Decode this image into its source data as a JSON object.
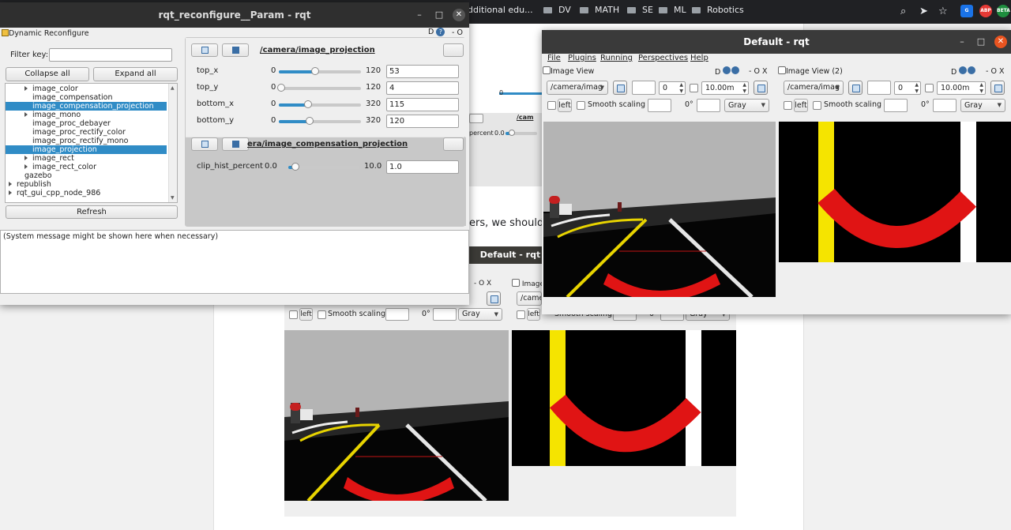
{
  "browser": {
    "bookmarks": [
      "dditional edu...",
      "DV",
      "MATH",
      "SE",
      "ML",
      "Robotics"
    ],
    "extensions": [
      "ABP",
      "BETA"
    ]
  },
  "doc": {
    "snippet": "ers, we should g"
  },
  "background_rqt": {
    "title": "Default - rqt",
    "param_fragment": "/cam",
    "clip_label": "percent",
    "clip_min": "0.0",
    "dock_label": "Image",
    "topic": "/camer",
    "left_label": "left",
    "smooth_label": "Smooth scaling",
    "rotation": "0°",
    "color_scheme": "Gray",
    "controls": "- O X"
  },
  "reconfigure_window": {
    "title": "rqt_reconfigure__Param - rqt",
    "plugin_title": "Dynamic Reconfigure",
    "dock_controls": "D",
    "dock_close": "- O X",
    "filter_label": "Filter key:",
    "filter_value": "",
    "collapse_all": "Collapse all",
    "expand_all": "Expand all",
    "tree": [
      {
        "label": "image_color",
        "indent": 2,
        "arrow": true,
        "selected": false
      },
      {
        "label": "image_compensation",
        "indent": 2,
        "arrow": false,
        "selected": false
      },
      {
        "label": "image_compensation_projection",
        "indent": 2,
        "arrow": false,
        "selected": true
      },
      {
        "label": "image_mono",
        "indent": 2,
        "arrow": true,
        "selected": false
      },
      {
        "label": "image_proc_debayer",
        "indent": 2,
        "arrow": false,
        "selected": false
      },
      {
        "label": "image_proc_rectify_color",
        "indent": 2,
        "arrow": false,
        "selected": false
      },
      {
        "label": "image_proc_rectify_mono",
        "indent": 2,
        "arrow": false,
        "selected": false
      },
      {
        "label": "image_projection",
        "indent": 2,
        "arrow": false,
        "selected": true
      },
      {
        "label": "image_rect",
        "indent": 2,
        "arrow": true,
        "selected": false
      },
      {
        "label": "image_rect_color",
        "indent": 2,
        "arrow": true,
        "selected": false
      },
      {
        "label": "gazebo",
        "indent": 1,
        "arrow": false,
        "selected": false
      },
      {
        "label": "republish",
        "indent": 0,
        "arrow": true,
        "selected": false
      },
      {
        "label": "rqt_gui_cpp_node_986",
        "indent": 0,
        "arrow": true,
        "selected": false
      }
    ],
    "refresh": "Refresh",
    "group1": {
      "title": "/camera/image_projection",
      "params": [
        {
          "name": "top_x",
          "min": "0",
          "max": "120",
          "value": "53",
          "fraction": 0.44
        },
        {
          "name": "top_y",
          "min": "0",
          "max": "120",
          "value": "4",
          "fraction": 0.03
        },
        {
          "name": "bottom_x",
          "min": "0",
          "max": "320",
          "value": "115",
          "fraction": 0.36
        },
        {
          "name": "bottom_y",
          "min": "0",
          "max": "320",
          "value": "120",
          "fraction": 0.375
        }
      ]
    },
    "group2": {
      "title": "era/image_compensation_projection",
      "params": [
        {
          "name": "clip_hist_percent",
          "min": "0.0",
          "max": "10.0",
          "value": "1.0",
          "fraction": 0.1
        }
      ]
    },
    "system_message": "(System message might be shown here when necessary)"
  },
  "rqt_window": {
    "title": "Default - rqt",
    "menu": [
      "File",
      "Plugins",
      "Running",
      "Perspectives",
      "Help"
    ],
    "view1": {
      "title": "Image View",
      "topic": "/camera/imag",
      "spin_value": "0",
      "duration": "10.00m",
      "left_label": "left",
      "smooth_label": "Smooth scaling",
      "rotation": "0°",
      "color_scheme": "Gray",
      "controls": "D",
      "close": "- O X"
    },
    "view2": {
      "title": "Image View (2)",
      "topic": "/camera/imag",
      "spin_value": "0",
      "duration": "10.00m",
      "left_label": "left",
      "smooth_label": "Smooth scaling",
      "rotation": "0°",
      "color_scheme": "Gray",
      "controls": "D",
      "close": "- O X"
    }
  },
  "colors": {
    "selection": "#308cc6",
    "title_bar": "#3a3a3a",
    "close_button": "#e95420"
  }
}
